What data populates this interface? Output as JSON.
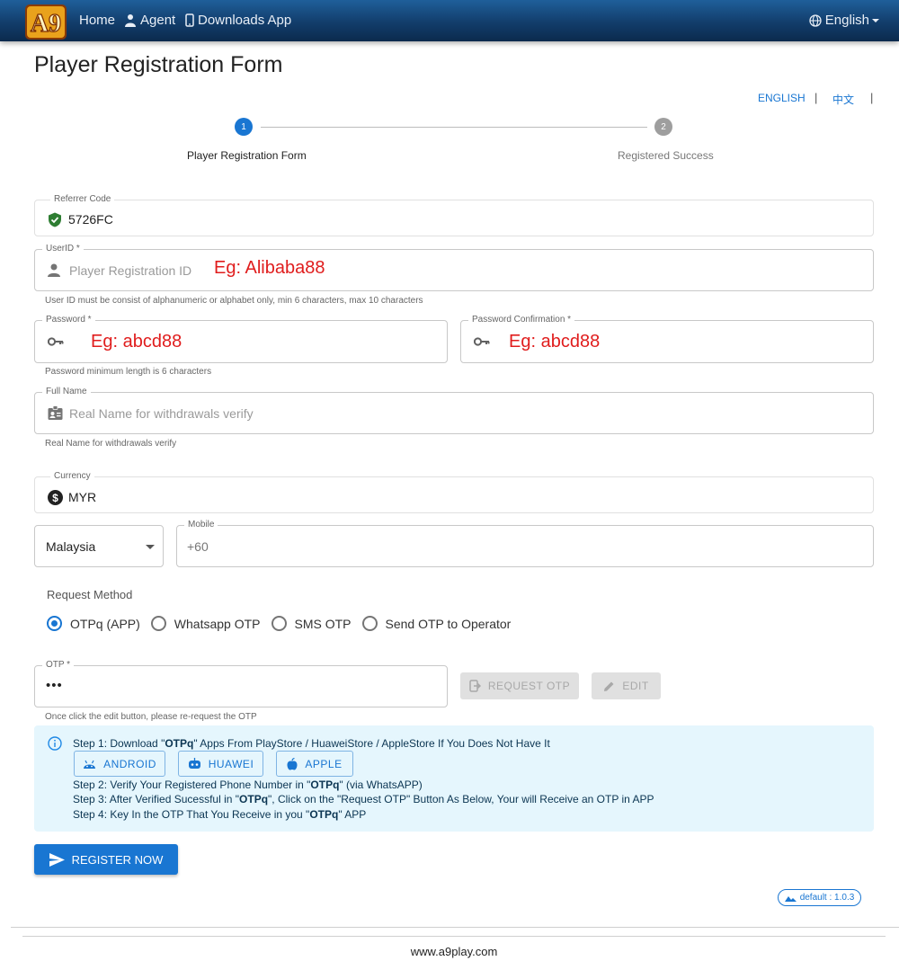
{
  "nav": {
    "logo_text": "A9",
    "home": "Home",
    "agent": "Agent",
    "downloads": "Downloads App",
    "language": "English"
  },
  "page_title": "Player Registration Form",
  "lang_switch": {
    "english": "ENGLISH",
    "chinese": "中文",
    "separator": "|"
  },
  "stepper": {
    "step1_number": "1",
    "step1_label": "Player Registration Form",
    "step2_number": "2",
    "step2_label": "Registered Success"
  },
  "referrer": {
    "label": "Referrer Code",
    "value": "5726FC"
  },
  "userid": {
    "label": "UserID *",
    "placeholder": "Player Registration ID",
    "example": "Eg: Alibaba88",
    "helper": "User ID must be consist of alphanumeric or alphabet only, min 6 characters, max 10 characters"
  },
  "password": {
    "label": "Password *",
    "example": "Eg: abcd88",
    "helper": "Password minimum length is 6 characters"
  },
  "password_confirm": {
    "label": "Password Confirmation *",
    "example": "Eg: abcd88"
  },
  "fullname": {
    "label": "Full Name",
    "placeholder": "Real Name for withdrawals verify",
    "helper": "Real Name for withdrawals verify"
  },
  "currency": {
    "label": "Currency",
    "value": "MYR"
  },
  "country": {
    "value": "Malaysia"
  },
  "mobile": {
    "label": "Mobile",
    "placeholder": "+60"
  },
  "request_method": {
    "label": "Request Method",
    "options": [
      "OTPq (APP)",
      "Whatsapp OTP",
      "SMS OTP",
      "Send OTP to Operator"
    ],
    "selected": "OTPq (APP)"
  },
  "otp": {
    "label": "OTP *",
    "value": "•••",
    "request_button": "REQUEST OTP",
    "edit_button": "EDIT",
    "helper": "Once click the edit button, please re-request the OTP"
  },
  "info": {
    "step1_a": "Step 1: Download \"",
    "step1_b": "OTPq",
    "step1_c": "\" Apps From PlayStore / HuaweiStore / AppleStore If You Does Not Have It",
    "android": "ANDROID",
    "huawei": "HUAWEI",
    "apple": "APPLE",
    "step2_a": "Step 2: Verify Your Registered Phone Number in \"",
    "step2_b": "OTPq",
    "step2_c": "\" (via WhatsAPP)",
    "step3_a": "Step 3: After Verified Sucessful in \"",
    "step3_b": "OTPq",
    "step3_c": "\", Click on the \"Request OTP\" Button As Below, Your will Receive an OTP in APP",
    "step4_a": "Step 4: Key In the OTP That You Receive in you \"",
    "step4_b": "OTPq",
    "step4_c": "\" APP"
  },
  "register_button": "REGISTER NOW",
  "version": "default : 1.0.3",
  "footer": "www.a9play.com",
  "colors": {
    "primary": "#1976d2",
    "nav_bg": "#123d6b",
    "example_red": "#e01d1d",
    "info_bg": "#e5f6fd",
    "shield_green": "#2e7d32"
  }
}
